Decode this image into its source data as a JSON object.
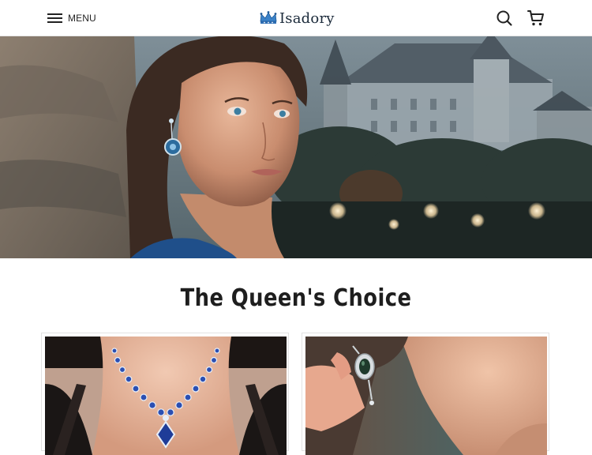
{
  "header": {
    "menu_label": "MENU",
    "brand_name": "Isadory",
    "icons": [
      "hamburger-menu-icon",
      "crown-logo-icon",
      "search-icon",
      "cart-icon"
    ]
  },
  "hero": {
    "image_alt": "Woman wearing blue earrings in front of a castle"
  },
  "section": {
    "title": "The Queen's Choice"
  },
  "products": [
    {
      "image_alt": "Blue sapphire necklace"
    },
    {
      "image_alt": "Emerald halo drop earring"
    }
  ],
  "colors": {
    "accent_blue": "#2f6fb5",
    "text_dark": "#1e1e1e"
  }
}
